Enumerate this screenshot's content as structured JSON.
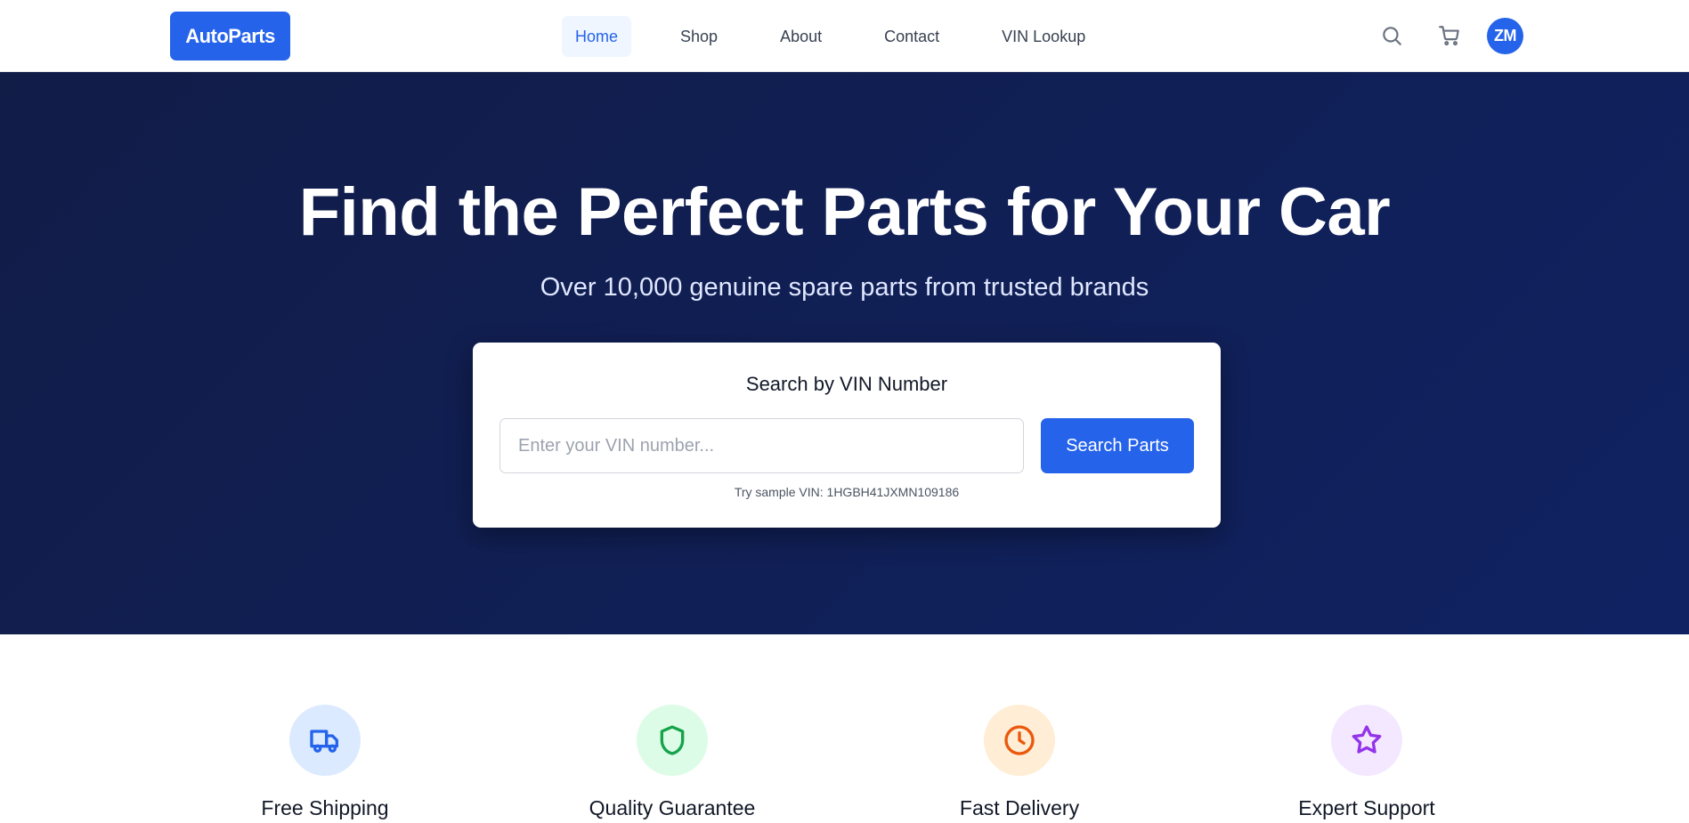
{
  "nav": {
    "logo": "AutoParts",
    "links": [
      {
        "label": "Home",
        "active": true
      },
      {
        "label": "Shop",
        "active": false
      },
      {
        "label": "About",
        "active": false
      },
      {
        "label": "Contact",
        "active": false
      },
      {
        "label": "VIN Lookup",
        "active": false
      }
    ],
    "icons": [
      "search-icon",
      "cart-icon"
    ],
    "avatar_initials": "ZM"
  },
  "hero": {
    "title": "Find the Perfect Parts for Your Car",
    "subtitle": "Over 10,000 genuine spare parts from trusted brands",
    "search": {
      "title": "Search by VIN Number",
      "input_value": "",
      "placeholder": "Enter your VIN number...",
      "button_label": "Search Parts",
      "sample": "Try sample VIN: 1HGBH41JXMN109186"
    }
  },
  "features": [
    {
      "title": "Free Shipping",
      "icon": "truck-icon",
      "color": "#2563eb",
      "bg": "#dbeafe"
    },
    {
      "title": "Quality Guarantee",
      "icon": "shield-icon",
      "color": "#16a34a",
      "bg": "#dcfce7"
    },
    {
      "title": "Fast Delivery",
      "icon": "clock-icon",
      "color": "#ea580c",
      "bg": "#ffedd5"
    },
    {
      "title": "Expert Support",
      "icon": "star-icon",
      "color": "#9333ea",
      "bg": "#f3e8ff"
    }
  ],
  "colors": {
    "primary": "#2563eb",
    "hero_bg": "#0f1f5c",
    "text": "#111827"
  }
}
